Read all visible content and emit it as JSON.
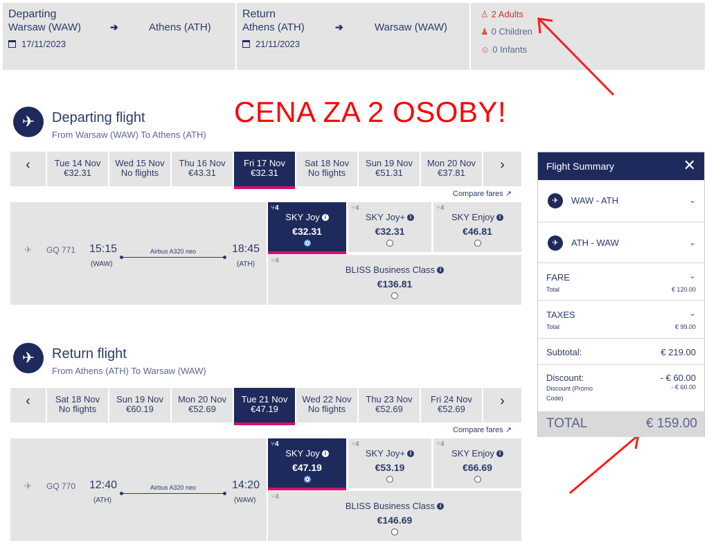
{
  "search": {
    "depart": {
      "label": "Departing",
      "from": "Warsaw (WAW)",
      "to": "Athens (ATH)",
      "date": "17/11/2023"
    },
    "ret": {
      "label": "Return",
      "from": "Athens (ATH)",
      "to": "Warsaw (WAW)",
      "date": "21/11/2023"
    },
    "pax": {
      "adults": "2 Adults",
      "children": "0 Children",
      "infants": "0 Infants"
    }
  },
  "annotation": "CENA ZA 2 OSOBY!",
  "departing": {
    "title": "Departing flight",
    "subtitle": "From Warsaw (WAW) To Athens (ATH)",
    "dates": [
      {
        "d": "Tue 14 Nov",
        "p": "€32.31"
      },
      {
        "d": "Wed 15 Nov",
        "p": "No flights"
      },
      {
        "d": "Thu 16 Nov",
        "p": "€43.31"
      },
      {
        "d": "Fri 17 Nov",
        "p": "€32.31"
      },
      {
        "d": "Sat 18 Nov",
        "p": "No flights"
      },
      {
        "d": "Sun 19 Nov",
        "p": "€51.31"
      },
      {
        "d": "Mon 20 Nov",
        "p": "€37.81"
      }
    ],
    "compare": "Compare fares",
    "flight": {
      "num": "GQ 771",
      "dep": "15:15",
      "dep_ap": "(WAW)",
      "arr": "18:45",
      "arr_ap": "(ATH)",
      "aircraft": "Airbus A320 neo"
    },
    "fares": [
      {
        "seat": "4",
        "name": "SKY Joy",
        "price": "€32.31"
      },
      {
        "seat": "4",
        "name": "SKY Joy+",
        "price": "€32.31"
      },
      {
        "seat": "4",
        "name": "SKY Enjoy",
        "price": "€46.81"
      },
      {
        "seat": "4",
        "name": "BLISS Business Class",
        "price": "€136.81"
      }
    ]
  },
  "returning": {
    "title": "Return flight",
    "subtitle": "From Athens (ATH) To Warsaw (WAW)",
    "dates": [
      {
        "d": "Sat 18 Nov",
        "p": "No flights"
      },
      {
        "d": "Sun 19 Nov",
        "p": "€60.19"
      },
      {
        "d": "Mon 20 Nov",
        "p": "€52.69"
      },
      {
        "d": "Tue 21 Nov",
        "p": "€47.19"
      },
      {
        "d": "Wed 22 Nov",
        "p": "No flights"
      },
      {
        "d": "Thu 23 Nov",
        "p": "€52.69"
      },
      {
        "d": "Fri 24 Nov",
        "p": "€52.69"
      }
    ],
    "compare": "Compare fares",
    "flight": {
      "num": "GQ 770",
      "dep": "12:40",
      "dep_ap": "(ATH)",
      "arr": "14:20",
      "arr_ap": "(WAW)",
      "aircraft": "Airbus A320 neo"
    },
    "fares": [
      {
        "seat": "4",
        "name": "SKY Joy",
        "price": "€47.19"
      },
      {
        "seat": "4",
        "name": "SKY Joy+",
        "price": "€53.19"
      },
      {
        "seat": "4",
        "name": "SKY Enjoy",
        "price": "€66.69"
      },
      {
        "seat": "4",
        "name": "BLISS Business Class",
        "price": "€146.69"
      }
    ]
  },
  "summary": {
    "title": "Flight Summary",
    "route1": "WAW - ATH",
    "route2": "ATH - WAW",
    "fare_label": "FARE",
    "fare_total_label": "Total",
    "fare_total": "€ 120.00",
    "taxes_label": "TAXES",
    "taxes_total_label": "Total",
    "taxes_total": "€ 99.00",
    "subtotal_label": "Subtotal:",
    "subtotal": "€ 219.00",
    "discount_label": "Discount:",
    "discount": "- € 60.00",
    "promo_label": "Discount (Promo Code)",
    "promo": "- € 60.00",
    "total_label": "TOTAL",
    "total": "€ 159.00"
  },
  "colors": {
    "navy": "#1e2a5c",
    "accent": "#d4126f",
    "annotation": "#ff0000"
  }
}
